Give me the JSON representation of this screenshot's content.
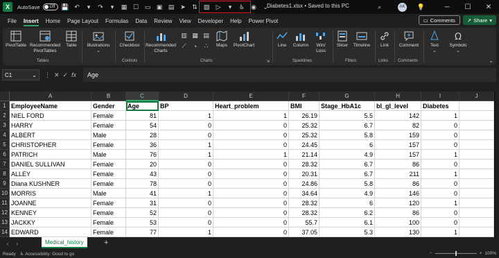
{
  "title_bar": {
    "autosave_label": "AutoSave",
    "autosave_state": "Off",
    "doc_title": "Diabetes1.xlsx • Saved to this PC",
    "user_initials": "AK"
  },
  "menu": {
    "tabs": [
      "File",
      "Insert",
      "Home",
      "Page Layout",
      "Formulas",
      "Data",
      "Review",
      "View",
      "Developer",
      "Help",
      "Power Pivot"
    ],
    "active_tab": "Insert",
    "comments_label": "Comments",
    "share_label": "Share"
  },
  "ribbon": {
    "tables": {
      "pivottable": "PivotTable",
      "recommended": "Recommended PivotTables",
      "table": "Table",
      "label": "Tables"
    },
    "illustrations": "Illustrations",
    "controls": {
      "checkbox": "Checkbox",
      "label": "Controls"
    },
    "charts": {
      "recommended": "Recommended Charts",
      "maps": "Maps",
      "pivotchart": "PivotChart",
      "label": "Charts"
    },
    "sparklines": {
      "line": "Line",
      "column": "Column",
      "winloss": "Win/ Loss",
      "label": "Sparklines"
    },
    "filters": {
      "slicer": "Slicer",
      "timeline": "Timeline",
      "label": "Filters"
    },
    "links": {
      "link": "Link",
      "label": "Links"
    },
    "comments": {
      "comment": "Comment",
      "label": "Comments"
    },
    "text": "Text",
    "symbols": "Symbols"
  },
  "formula_bar": {
    "name_box": "C1",
    "fx": "fx",
    "content": "Age"
  },
  "grid": {
    "columns": [
      "A",
      "B",
      "C",
      "D",
      "E",
      "F",
      "G",
      "H",
      "I",
      "J"
    ],
    "selected_column": "C",
    "rows": [
      "1",
      "2",
      "3",
      "4",
      "5",
      "6",
      "7",
      "8",
      "9",
      "10",
      "11",
      "12",
      "13",
      "14"
    ],
    "headers": [
      "EmployeeName",
      "Gender",
      "Age",
      "BP",
      "Heart_problem",
      "BMI",
      "Stage_HbA1c",
      "bl_gl_level",
      "Diabetes"
    ],
    "data": [
      [
        "NIEL FORD",
        "Female",
        "81",
        "1",
        "1",
        "26.19",
        "5.5",
        "142",
        "1"
      ],
      [
        "HARRY",
        "Female",
        "54",
        "0",
        "0",
        "25.32",
        "6.7",
        "82",
        "0"
      ],
      [
        "ALBERT",
        "Male",
        "28",
        "0",
        "0",
        "25.32",
        "5.8",
        "159",
        "0"
      ],
      [
        "CHRISTOPHER",
        "Female",
        "36",
        "1",
        "0",
        "24.45",
        "6",
        "157",
        "0"
      ],
      [
        "PATRICH",
        "Male",
        "76",
        "1",
        "1",
        "21.14",
        "4.9",
        "157",
        "1"
      ],
      [
        "DANIEL SULLIVAN",
        "Female",
        "20",
        "0",
        "0",
        "28.32",
        "6.7",
        "86",
        "0"
      ],
      [
        "ALLEY",
        "Female",
        "43",
        "0",
        "0",
        "20.31",
        "6.7",
        "211",
        "1"
      ],
      [
        "Diana KUSHNER",
        "Female",
        "78",
        "0",
        "0",
        "24.86",
        "5.8",
        "86",
        "0"
      ],
      [
        "MORRIS",
        "Male",
        "41",
        "1",
        "0",
        "34.64",
        "4.9",
        "146",
        "0"
      ],
      [
        "JOANNE",
        "Female",
        "31",
        "0",
        "0",
        "28.32",
        "6",
        "120",
        "1"
      ],
      [
        "KENNEY",
        "Female",
        "52",
        "0",
        "0",
        "28.32",
        "6.2",
        "86",
        "0"
      ],
      [
        "JACKKY",
        "Female",
        "53",
        "0",
        "0",
        "55.7",
        "6.1",
        "100",
        "0"
      ],
      [
        "EDWARD",
        "Female",
        "77",
        "1",
        "0",
        "37.05",
        "5.3",
        "130",
        "1"
      ]
    ]
  },
  "sheet_tabs": {
    "active": "Medical_history"
  },
  "status_bar": {
    "ready": "Ready",
    "accessibility": "Accessibility: Good to go",
    "zoom": "100%"
  }
}
